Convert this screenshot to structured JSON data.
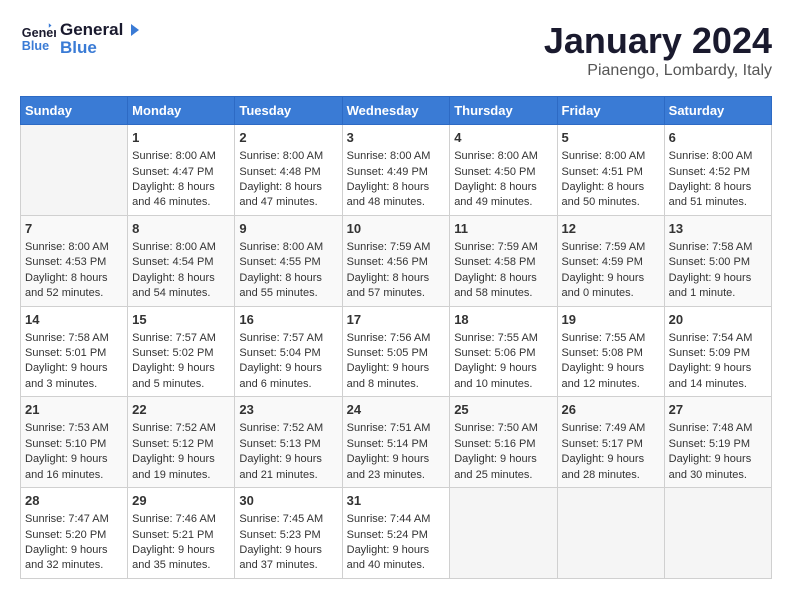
{
  "logo": {
    "line1": "General",
    "line2": "Blue"
  },
  "title": "January 2024",
  "subtitle": "Pianengo, Lombardy, Italy",
  "weekdays": [
    "Sunday",
    "Monday",
    "Tuesday",
    "Wednesday",
    "Thursday",
    "Friday",
    "Saturday"
  ],
  "weeks": [
    [
      {
        "day": "",
        "content": ""
      },
      {
        "day": "1",
        "content": "Sunrise: 8:00 AM\nSunset: 4:47 PM\nDaylight: 8 hours\nand 46 minutes."
      },
      {
        "day": "2",
        "content": "Sunrise: 8:00 AM\nSunset: 4:48 PM\nDaylight: 8 hours\nand 47 minutes."
      },
      {
        "day": "3",
        "content": "Sunrise: 8:00 AM\nSunset: 4:49 PM\nDaylight: 8 hours\nand 48 minutes."
      },
      {
        "day": "4",
        "content": "Sunrise: 8:00 AM\nSunset: 4:50 PM\nDaylight: 8 hours\nand 49 minutes."
      },
      {
        "day": "5",
        "content": "Sunrise: 8:00 AM\nSunset: 4:51 PM\nDaylight: 8 hours\nand 50 minutes."
      },
      {
        "day": "6",
        "content": "Sunrise: 8:00 AM\nSunset: 4:52 PM\nDaylight: 8 hours\nand 51 minutes."
      }
    ],
    [
      {
        "day": "7",
        "content": "Sunrise: 8:00 AM\nSunset: 4:53 PM\nDaylight: 8 hours\nand 52 minutes."
      },
      {
        "day": "8",
        "content": "Sunrise: 8:00 AM\nSunset: 4:54 PM\nDaylight: 8 hours\nand 54 minutes."
      },
      {
        "day": "9",
        "content": "Sunrise: 8:00 AM\nSunset: 4:55 PM\nDaylight: 8 hours\nand 55 minutes."
      },
      {
        "day": "10",
        "content": "Sunrise: 7:59 AM\nSunset: 4:56 PM\nDaylight: 8 hours\nand 57 minutes."
      },
      {
        "day": "11",
        "content": "Sunrise: 7:59 AM\nSunset: 4:58 PM\nDaylight: 8 hours\nand 58 minutes."
      },
      {
        "day": "12",
        "content": "Sunrise: 7:59 AM\nSunset: 4:59 PM\nDaylight: 9 hours\nand 0 minutes."
      },
      {
        "day": "13",
        "content": "Sunrise: 7:58 AM\nSunset: 5:00 PM\nDaylight: 9 hours\nand 1 minute."
      }
    ],
    [
      {
        "day": "14",
        "content": "Sunrise: 7:58 AM\nSunset: 5:01 PM\nDaylight: 9 hours\nand 3 minutes."
      },
      {
        "day": "15",
        "content": "Sunrise: 7:57 AM\nSunset: 5:02 PM\nDaylight: 9 hours\nand 5 minutes."
      },
      {
        "day": "16",
        "content": "Sunrise: 7:57 AM\nSunset: 5:04 PM\nDaylight: 9 hours\nand 6 minutes."
      },
      {
        "day": "17",
        "content": "Sunrise: 7:56 AM\nSunset: 5:05 PM\nDaylight: 9 hours\nand 8 minutes."
      },
      {
        "day": "18",
        "content": "Sunrise: 7:55 AM\nSunset: 5:06 PM\nDaylight: 9 hours\nand 10 minutes."
      },
      {
        "day": "19",
        "content": "Sunrise: 7:55 AM\nSunset: 5:08 PM\nDaylight: 9 hours\nand 12 minutes."
      },
      {
        "day": "20",
        "content": "Sunrise: 7:54 AM\nSunset: 5:09 PM\nDaylight: 9 hours\nand 14 minutes."
      }
    ],
    [
      {
        "day": "21",
        "content": "Sunrise: 7:53 AM\nSunset: 5:10 PM\nDaylight: 9 hours\nand 16 minutes."
      },
      {
        "day": "22",
        "content": "Sunrise: 7:52 AM\nSunset: 5:12 PM\nDaylight: 9 hours\nand 19 minutes."
      },
      {
        "day": "23",
        "content": "Sunrise: 7:52 AM\nSunset: 5:13 PM\nDaylight: 9 hours\nand 21 minutes."
      },
      {
        "day": "24",
        "content": "Sunrise: 7:51 AM\nSunset: 5:14 PM\nDaylight: 9 hours\nand 23 minutes."
      },
      {
        "day": "25",
        "content": "Sunrise: 7:50 AM\nSunset: 5:16 PM\nDaylight: 9 hours\nand 25 minutes."
      },
      {
        "day": "26",
        "content": "Sunrise: 7:49 AM\nSunset: 5:17 PM\nDaylight: 9 hours\nand 28 minutes."
      },
      {
        "day": "27",
        "content": "Sunrise: 7:48 AM\nSunset: 5:19 PM\nDaylight: 9 hours\nand 30 minutes."
      }
    ],
    [
      {
        "day": "28",
        "content": "Sunrise: 7:47 AM\nSunset: 5:20 PM\nDaylight: 9 hours\nand 32 minutes."
      },
      {
        "day": "29",
        "content": "Sunrise: 7:46 AM\nSunset: 5:21 PM\nDaylight: 9 hours\nand 35 minutes."
      },
      {
        "day": "30",
        "content": "Sunrise: 7:45 AM\nSunset: 5:23 PM\nDaylight: 9 hours\nand 37 minutes."
      },
      {
        "day": "31",
        "content": "Sunrise: 7:44 AM\nSunset: 5:24 PM\nDaylight: 9 hours\nand 40 minutes."
      },
      {
        "day": "",
        "content": ""
      },
      {
        "day": "",
        "content": ""
      },
      {
        "day": "",
        "content": ""
      }
    ]
  ]
}
